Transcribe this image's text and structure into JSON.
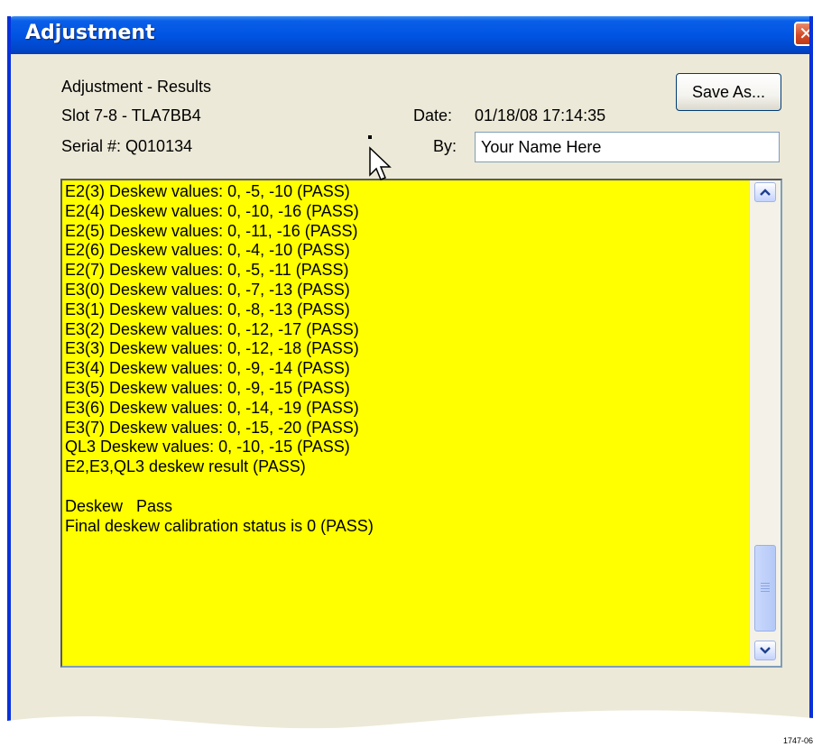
{
  "window": {
    "title": "Adjustment",
    "close_icon": "close-icon"
  },
  "header": {
    "heading": "Adjustment - Results",
    "slot": "Slot 7-8 - TLA7BB4",
    "serial": "Serial #: Q010134",
    "date_label": "Date:",
    "date_value": "01/18/08 17:14:35",
    "by_label": "By:",
    "by_value": "Your Name Here",
    "save_label": "Save As..."
  },
  "results": {
    "background": "#ffff00",
    "lines": [
      "E2(3) Deskew values: 0, -5, -10 (PASS)",
      "E2(4) Deskew values: 0, -10, -16 (PASS)",
      "E2(5) Deskew values: 0, -11, -16 (PASS)",
      "E2(6) Deskew values: 0, -4, -10 (PASS)",
      "E2(7) Deskew values: 0, -5, -11 (PASS)",
      "E3(0) Deskew values: 0, -7, -13 (PASS)",
      "E3(1) Deskew values: 0, -8, -13 (PASS)",
      "E3(2) Deskew values: 0, -12, -17 (PASS)",
      "E3(3) Deskew values: 0, -12, -18 (PASS)",
      "E3(4) Deskew values: 0, -9, -14 (PASS)",
      "E3(5) Deskew values: 0, -9, -15 (PASS)",
      "E3(6) Deskew values: 0, -14, -19 (PASS)",
      "E3(7) Deskew values: 0, -15, -20 (PASS)",
      "QL3 Deskew values: 0, -10, -15 (PASS)",
      "E2,E3,QL3 deskew result (PASS)",
      "",
      "Deskew   Pass",
      "Final deskew calibration status is 0 (PASS)"
    ]
  },
  "figure_number": "1747-06"
}
